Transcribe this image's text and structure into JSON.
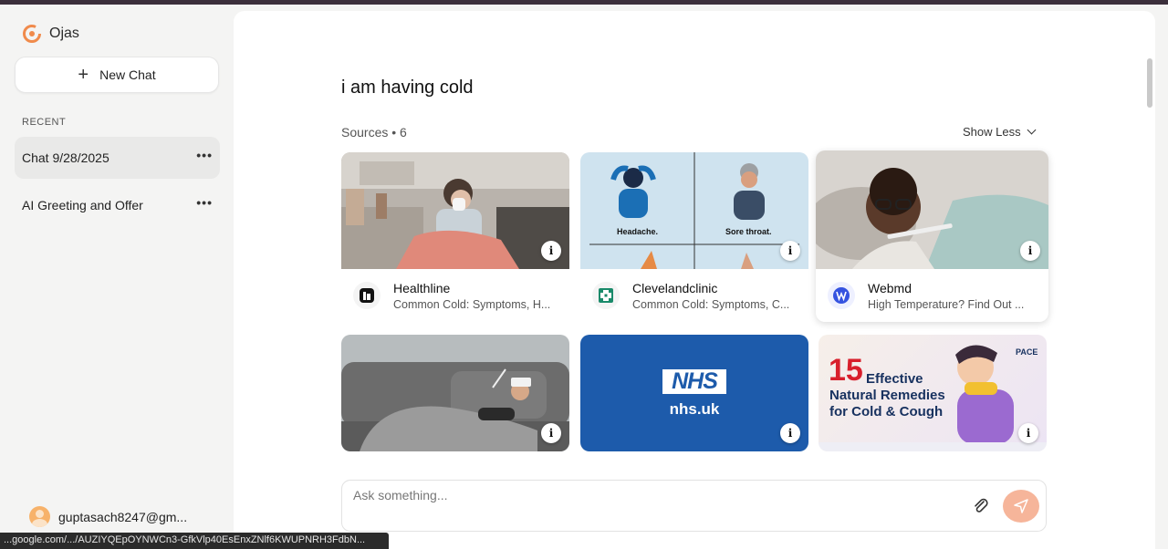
{
  "app": {
    "name": "Ojas"
  },
  "sidebar": {
    "new_chat_label": "New Chat",
    "recent_label": "RECENT",
    "chats": [
      {
        "title": "Chat 9/28/2025",
        "active": true
      },
      {
        "title": "AI Greeting and Offer",
        "active": false
      }
    ],
    "more_label": "•••",
    "user_email": "guptasach8247@gm..."
  },
  "status_url": "...google.com/.../AUZIYQEpOYNWCn3-GfkVlp40EsEnxZNlf6KWUPNRH3FdbN...",
  "main": {
    "question": "i am having cold",
    "sources_label": "Sources • 6",
    "show_less_label": "Show Less",
    "info_label": "i",
    "sources": [
      {
        "site": "Healthline",
        "desc": "Common Cold: Symptoms, H...",
        "favicon": "healthline-icon"
      },
      {
        "site": "Clevelandclinic",
        "desc": "Common Cold: Symptoms, C...",
        "favicon": "clevelandclinic-icon",
        "captions": [
          "Headache.",
          "Sore throat."
        ]
      },
      {
        "site": "Webmd",
        "desc": "High Temperature? Find Out ...",
        "favicon": "webmd-icon"
      },
      {
        "site": "",
        "desc": "",
        "favicon": ""
      },
      {
        "site": "",
        "desc": "",
        "favicon": "",
        "logo_text": "NHS",
        "domain_text": "nhs.uk"
      },
      {
        "site": "",
        "desc": "",
        "favicon": "",
        "headline_num": "15",
        "headline_text": "Effective",
        "headline_sub1": "Natural Remedies",
        "headline_sub2": "for Cold & Cough",
        "brand_text": "PACE"
      }
    ],
    "input_placeholder": "Ask something..."
  },
  "colors": {
    "accent": "#f08a4b",
    "send_button": "#f6b59a",
    "nhs_blue": "#1d5bab"
  }
}
